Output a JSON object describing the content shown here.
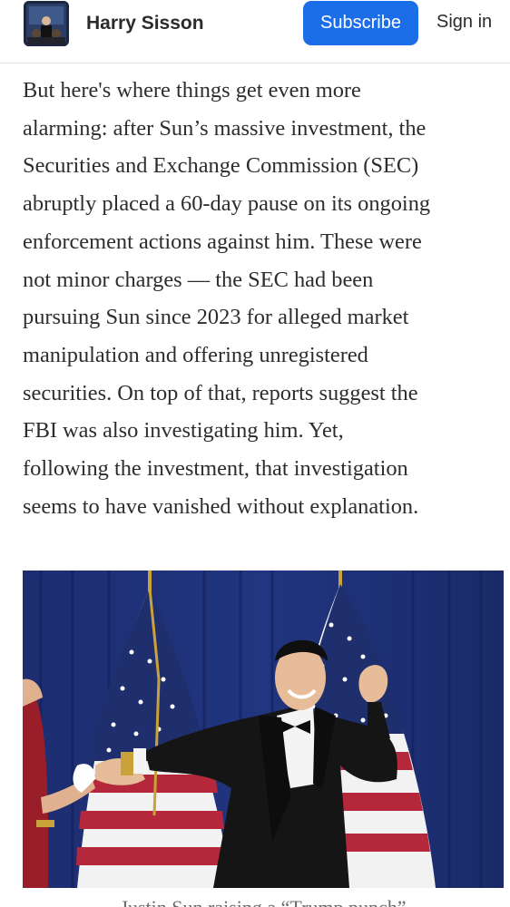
{
  "header": {
    "author_name": "Harry Sisson",
    "subscribe_label": "Subscribe",
    "signin_label": "Sign in",
    "avatar_icon": "author-avatar"
  },
  "article": {
    "lines": [
      "But here's where things get even more",
      "alarming: after Sun’s massive investment, the",
      "Securities and Exchange Commission (SEC)",
      "abruptly placed a 60-day pause on its ongoing",
      "enforcement actions against him. These were",
      "not minor charges — the SEC had been",
      "pursuing Sun since 2023 for alleged market",
      "manipulation and offering unregistered",
      "securities. On top of that, reports suggest the",
      "FBI was also investigating him. Yet,",
      "following the investment, that investigation",
      "seems to have vanished without explanation."
    ]
  },
  "image": {
    "caption_partial": "Justin Sun raising a “Trump punch”"
  },
  "colors": {
    "accent": "#1c6ee8",
    "curtain": "#1a2a6e"
  }
}
